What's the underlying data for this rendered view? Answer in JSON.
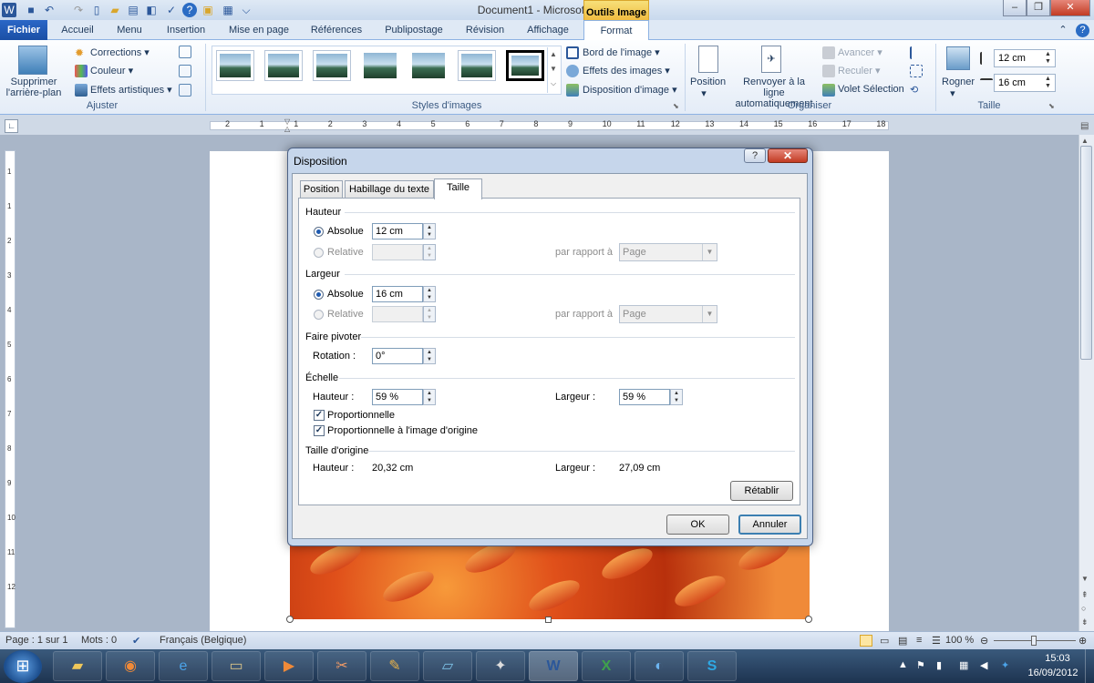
{
  "window": {
    "title": "Document1 - Microsoft Word",
    "context_tab_group": "Outils Image",
    "min": "–",
    "max": "❐",
    "close": "✕"
  },
  "tabs": [
    "Fichier",
    "Accueil",
    "Menu",
    "Insertion",
    "Mise en page",
    "Références",
    "Publipostage",
    "Révision",
    "Affichage",
    "Format"
  ],
  "ribbon": {
    "ajuster": {
      "group_label": "Ajuster",
      "remove_bg": "Supprimer l'arrière-plan",
      "corrections": "Corrections",
      "couleur": "Couleur",
      "effets": "Effets artistiques"
    },
    "styles": {
      "group_label": "Styles d'images",
      "border": "Bord de l'image",
      "effects": "Effets des images",
      "layout": "Disposition d'image"
    },
    "organiser": {
      "group_label": "Organiser",
      "position": "Position",
      "wrap": "Renvoyer à la ligne automatiquement",
      "forward": "Avancer",
      "backward": "Reculer",
      "selection": "Volet Sélection"
    },
    "taille": {
      "group_label": "Taille",
      "crop": "Rogner",
      "height": "12 cm",
      "width": "16 cm"
    }
  },
  "ruler": [
    "2",
    "1",
    "1",
    "2",
    "3",
    "4",
    "5",
    "6",
    "7",
    "8",
    "9",
    "10",
    "11",
    "12",
    "13",
    "14",
    "15",
    "16",
    "17",
    "18"
  ],
  "vruler": [
    "1",
    "1",
    "2",
    "3",
    "4",
    "5",
    "6",
    "7",
    "8",
    "9",
    "10",
    "11",
    "12"
  ],
  "dialog": {
    "title": "Disposition",
    "help": "?",
    "close": "✕",
    "tabs": {
      "position": "Position",
      "habillage": "Habillage du texte",
      "taille": "Taille"
    },
    "hauteur": {
      "section": "Hauteur",
      "absolue_label": "Absolue",
      "absolue_value": "12 cm",
      "relative_label": "Relative",
      "relative_value": "",
      "par_rapport": "par rapport à",
      "page": "Page"
    },
    "largeur": {
      "section": "Largeur",
      "absolue_label": "Absolue",
      "absolue_value": "16 cm",
      "relative_label": "Relative",
      "relative_value": "",
      "par_rapport": "par rapport à",
      "page": "Page"
    },
    "pivoter": {
      "section": "Faire pivoter",
      "rotation_label": "Rotation :",
      "rotation_value": "0°"
    },
    "echelle": {
      "section": "Échelle",
      "hauteur_label": "Hauteur :",
      "hauteur_value": "59 %",
      "largeur_label": "Largeur :",
      "largeur_value": "59 %",
      "proportionnelle": "Proportionnelle",
      "proportionnelle_origine": "Proportionnelle à l'image d'origine"
    },
    "origine": {
      "section": "Taille d'origine",
      "hauteur_label": "Hauteur :",
      "hauteur_value": "20,32 cm",
      "largeur_label": "Largeur :",
      "largeur_value": "27,09 cm"
    },
    "retablir": "Rétablir",
    "ok": "OK",
    "annuler": "Annuler"
  },
  "status": {
    "page": "Page : 1 sur 1",
    "mots": "Mots : 0",
    "langue": "Français (Belgique)",
    "zoom": "100 %"
  },
  "taskbar": {
    "time": "15:03",
    "date": "16/09/2012"
  },
  "colors": {
    "file_tab": "#2b67c7",
    "context_tab": "#f0b93a",
    "dialog_frame": "#c6d6eb"
  }
}
